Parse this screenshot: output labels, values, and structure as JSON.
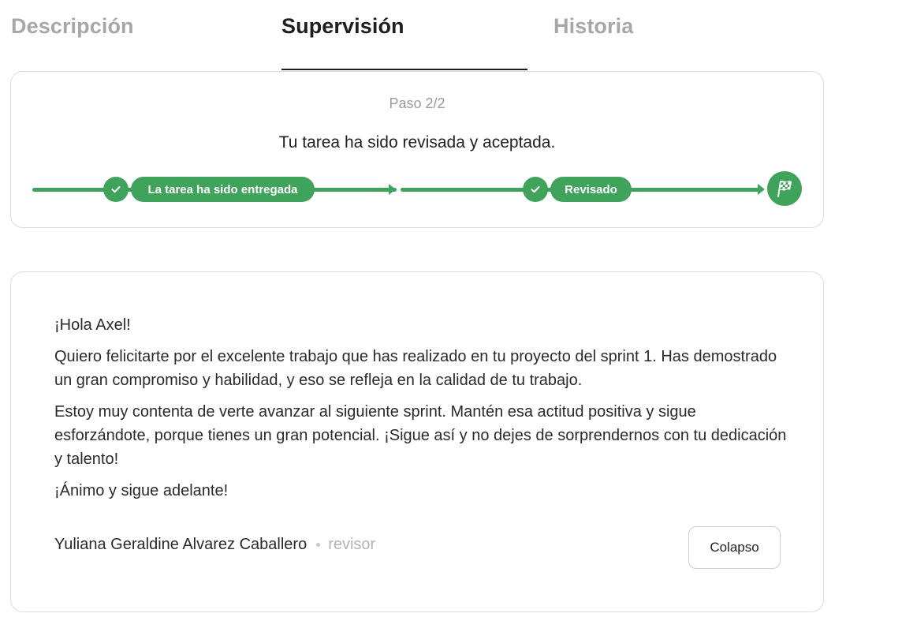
{
  "tabs": [
    {
      "label": "Descripción",
      "active": false
    },
    {
      "label": "Supervisión",
      "active": true
    },
    {
      "label": "Historia",
      "active": false
    }
  ],
  "progress": {
    "step_count": "Paso 2/2",
    "title": "Tu tarea ha sido revisada y aceptada.",
    "stages": [
      {
        "label": "La tarea ha sido entregada",
        "icon": "check-icon",
        "completed": true
      },
      {
        "label": "Revisado",
        "icon": "check-icon",
        "completed": true
      }
    ],
    "end_icon": "checkered-flag-icon",
    "accent_color": "#3fa35c"
  },
  "review": {
    "paragraphs": [
      "¡Hola Axel!",
      "Quiero felicitarte por el excelente trabajo que has realizado en tu proyecto del sprint 1. Has demostrado un gran compromiso y habilidad, y eso se refleja en la calidad de tu trabajo.",
      "Estoy muy contenta de verte avanzar al siguiente sprint. Mantén esa actitud positiva y sigue esforzándote, porque tienes un gran potencial. ¡Sigue así y no dejes de sorprendernos con tu dedicación y talento!",
      "¡Ánimo y sigue adelante!"
    ],
    "reviewer_name": "Yuliana Geraldine Alvarez Caballero",
    "reviewer_role": "revisor",
    "collapse_label": "Colapso"
  }
}
